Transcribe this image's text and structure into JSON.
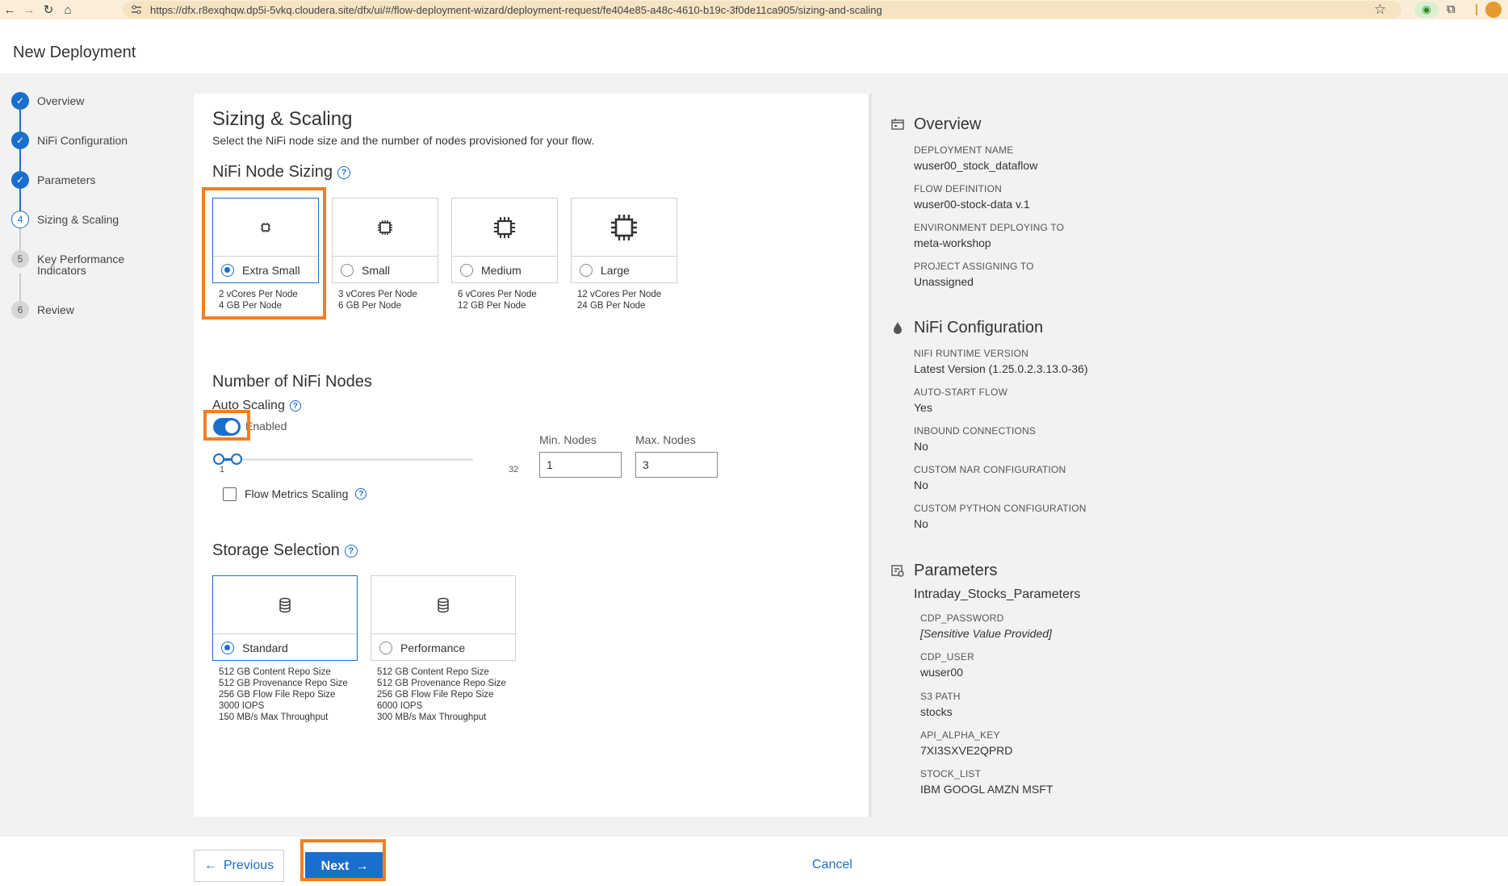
{
  "browser": {
    "url": "https://dfx.r8exqhqw.dp5i-5vkq.cloudera.site/dfx/ui/#/flow-deployment-wizard/deployment-request/fe404e85-a48c-4610-b19c-3f0de11ca905/sizing-and-scaling"
  },
  "page": {
    "title": "New Deployment"
  },
  "steps": [
    {
      "label": "Overview",
      "state": "done"
    },
    {
      "label": "NiFi Configuration",
      "state": "done"
    },
    {
      "label": "Parameters",
      "state": "done"
    },
    {
      "num": "4",
      "label": "Sizing & Scaling",
      "state": "active"
    },
    {
      "num": "5",
      "label": "Key Performance",
      "label2": "Indicators",
      "state": "pending"
    },
    {
      "num": "6",
      "label": "Review",
      "state": "pending"
    }
  ],
  "main": {
    "title": "Sizing & Scaling",
    "subtitle": "Select the NiFi node size and the number of nodes provisioned for your flow.",
    "node_sizing_title": "NiFi Node Sizing",
    "sizes": [
      {
        "label": "Extra Small",
        "vcores": "2 vCores Per Node",
        "mem": "4 GB Per Node",
        "selected": true
      },
      {
        "label": "Small",
        "vcores": "3 vCores Per Node",
        "mem": "6 GB Per Node",
        "selected": false
      },
      {
        "label": "Medium",
        "vcores": "6 vCores Per Node",
        "mem": "12 GB Per Node",
        "selected": false
      },
      {
        "label": "Large",
        "vcores": "12 vCores Per Node",
        "mem": "24 GB Per Node",
        "selected": false
      }
    ],
    "nodes_title": "Number of NiFi Nodes",
    "auto_scaling_label": "Auto Scaling",
    "toggle_state": "Enabled",
    "slider_min_label": "1",
    "slider_max_label": "32",
    "min_nodes_label": "Min. Nodes",
    "max_nodes_label": "Max. Nodes",
    "min_nodes_value": "1",
    "max_nodes_value": "3",
    "flow_metrics_label": "Flow Metrics Scaling",
    "storage_title": "Storage Selection",
    "storage": [
      {
        "label": "Standard",
        "selected": true,
        "lines": [
          "512 GB Content Repo Size",
          "512 GB Provenance Repo Size",
          "256 GB Flow File Repo Size",
          "3000 IOPS",
          "150 MB/s Max Throughput"
        ]
      },
      {
        "label": "Performance",
        "selected": false,
        "lines": [
          "512 GB Content Repo Size",
          "512 GB Provenance Repo Size",
          "256 GB Flow File Repo Size",
          "6000 IOPS",
          "300 MB/s Max Throughput"
        ]
      }
    ]
  },
  "summary": {
    "overview_title": "Overview",
    "overview": [
      {
        "label": "DEPLOYMENT NAME",
        "value": "wuser00_stock_dataflow"
      },
      {
        "label": "FLOW DEFINITION",
        "value": "wuser00-stock-data v.1"
      },
      {
        "label": "ENVIRONMENT DEPLOYING TO",
        "value": "meta-workshop"
      },
      {
        "label": "PROJECT ASSIGNING TO",
        "value": "Unassigned"
      }
    ],
    "nifi_title": "NiFi Configuration",
    "nifi": [
      {
        "label": "NIFI RUNTIME VERSION",
        "value": "Latest Version (1.25.0.2.3.13.0-36)"
      },
      {
        "label": "AUTO-START FLOW",
        "value": "Yes"
      },
      {
        "label": "INBOUND CONNECTIONS",
        "value": "No"
      },
      {
        "label": "CUSTOM NAR CONFIGURATION",
        "value": "No"
      },
      {
        "label": "CUSTOM PYTHON CONFIGURATION",
        "value": "No"
      }
    ],
    "params_title": "Parameters",
    "param_group": "Intraday_Stocks_Parameters",
    "params": [
      {
        "label": "CDP_PASSWORD",
        "value": "[Sensitive Value Provided]"
      },
      {
        "label": "CDP_USER",
        "value": "wuser00"
      },
      {
        "label": "S3 PATH",
        "value": "stocks"
      },
      {
        "label": "API_ALPHA_KEY",
        "value": "7XI3SXVE2QPRD"
      },
      {
        "label": "STOCK_LIST",
        "value": "IBM GOOGL AMZN MSFT"
      }
    ]
  },
  "footer": {
    "previous_label": "Previous",
    "next_label": "Next",
    "cancel_label": "Cancel"
  },
  "colors": {
    "accent": "#1a6ecc",
    "highlight": "#f07f24"
  }
}
